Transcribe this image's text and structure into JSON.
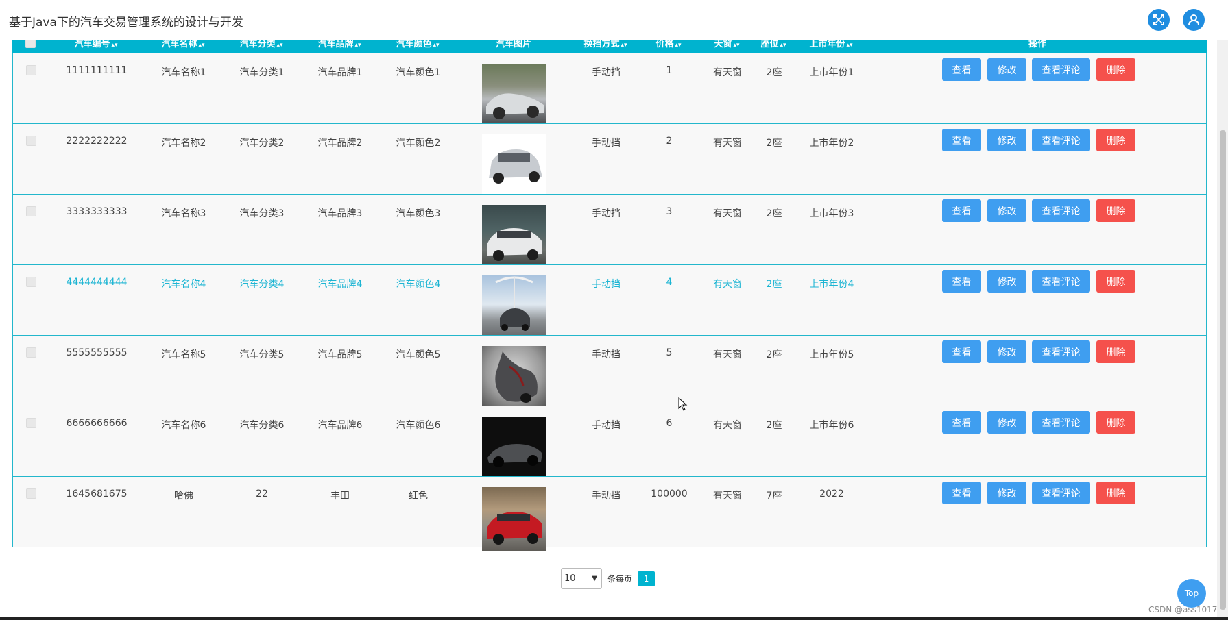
{
  "app": {
    "title": "基于Java下的汽车交易管理系统的设计与开发"
  },
  "table": {
    "headers": [
      "汽车编号",
      "汽车名称",
      "汽车分类",
      "汽车品牌",
      "汽车颜色",
      "汽车图片",
      "换挡方式",
      "价格",
      "天窗",
      "座位",
      "上市年份",
      "操作"
    ],
    "rows": [
      {
        "code": "1111111111",
        "name": "汽车名称1",
        "category": "汽车分类1",
        "brand": "汽车品牌1",
        "color": "汽车颜色1",
        "gear": "手动挡",
        "price": "1",
        "sunroof": "有天窗",
        "seats": "2座",
        "year": "上市年份1"
      },
      {
        "code": "2222222222",
        "name": "汽车名称2",
        "category": "汽车分类2",
        "brand": "汽车品牌2",
        "color": "汽车颜色2",
        "gear": "手动挡",
        "price": "2",
        "sunroof": "有天窗",
        "seats": "2座",
        "year": "上市年份2"
      },
      {
        "code": "3333333333",
        "name": "汽车名称3",
        "category": "汽车分类3",
        "brand": "汽车品牌3",
        "color": "汽车颜色3",
        "gear": "手动挡",
        "price": "3",
        "sunroof": "有天窗",
        "seats": "2座",
        "year": "上市年份3"
      },
      {
        "code": "4444444444",
        "name": "汽车名称4",
        "category": "汽车分类4",
        "brand": "汽车品牌4",
        "color": "汽车颜色4",
        "gear": "手动挡",
        "price": "4",
        "sunroof": "有天窗",
        "seats": "2座",
        "year": "上市年份4"
      },
      {
        "code": "5555555555",
        "name": "汽车名称5",
        "category": "汽车分类5",
        "brand": "汽车品牌5",
        "color": "汽车颜色5",
        "gear": "手动挡",
        "price": "5",
        "sunroof": "有天窗",
        "seats": "2座",
        "year": "上市年份5"
      },
      {
        "code": "6666666666",
        "name": "汽车名称6",
        "category": "汽车分类6",
        "brand": "汽车品牌6",
        "color": "汽车颜色6",
        "gear": "手动挡",
        "price": "6",
        "sunroof": "有天窗",
        "seats": "2座",
        "year": "上市年份6"
      },
      {
        "code": "1645681675",
        "name": "哈佛",
        "category": "22",
        "brand": "丰田",
        "color": "红色",
        "gear": "手动挡",
        "price": "100000",
        "sunroof": "有天窗",
        "seats": "7座",
        "year": "2022"
      }
    ],
    "actions": {
      "view": "查看",
      "edit": "修改",
      "comments": "查看评论",
      "delete": "删除"
    },
    "highlighted_row": 3
  },
  "pagination": {
    "page_size": "10",
    "per_page_label": "条每页",
    "current_page": "1"
  },
  "back_to_top": "Top",
  "watermark": "CSDN @ass1017",
  "colors": {
    "header": "#00b3cf",
    "primary_button": "#3f9ef0",
    "danger_button": "#f5514c",
    "highlight_text": "#1db5d3"
  },
  "icons": {
    "fullscreen": "fullscreen-icon",
    "user": "user-icon"
  }
}
